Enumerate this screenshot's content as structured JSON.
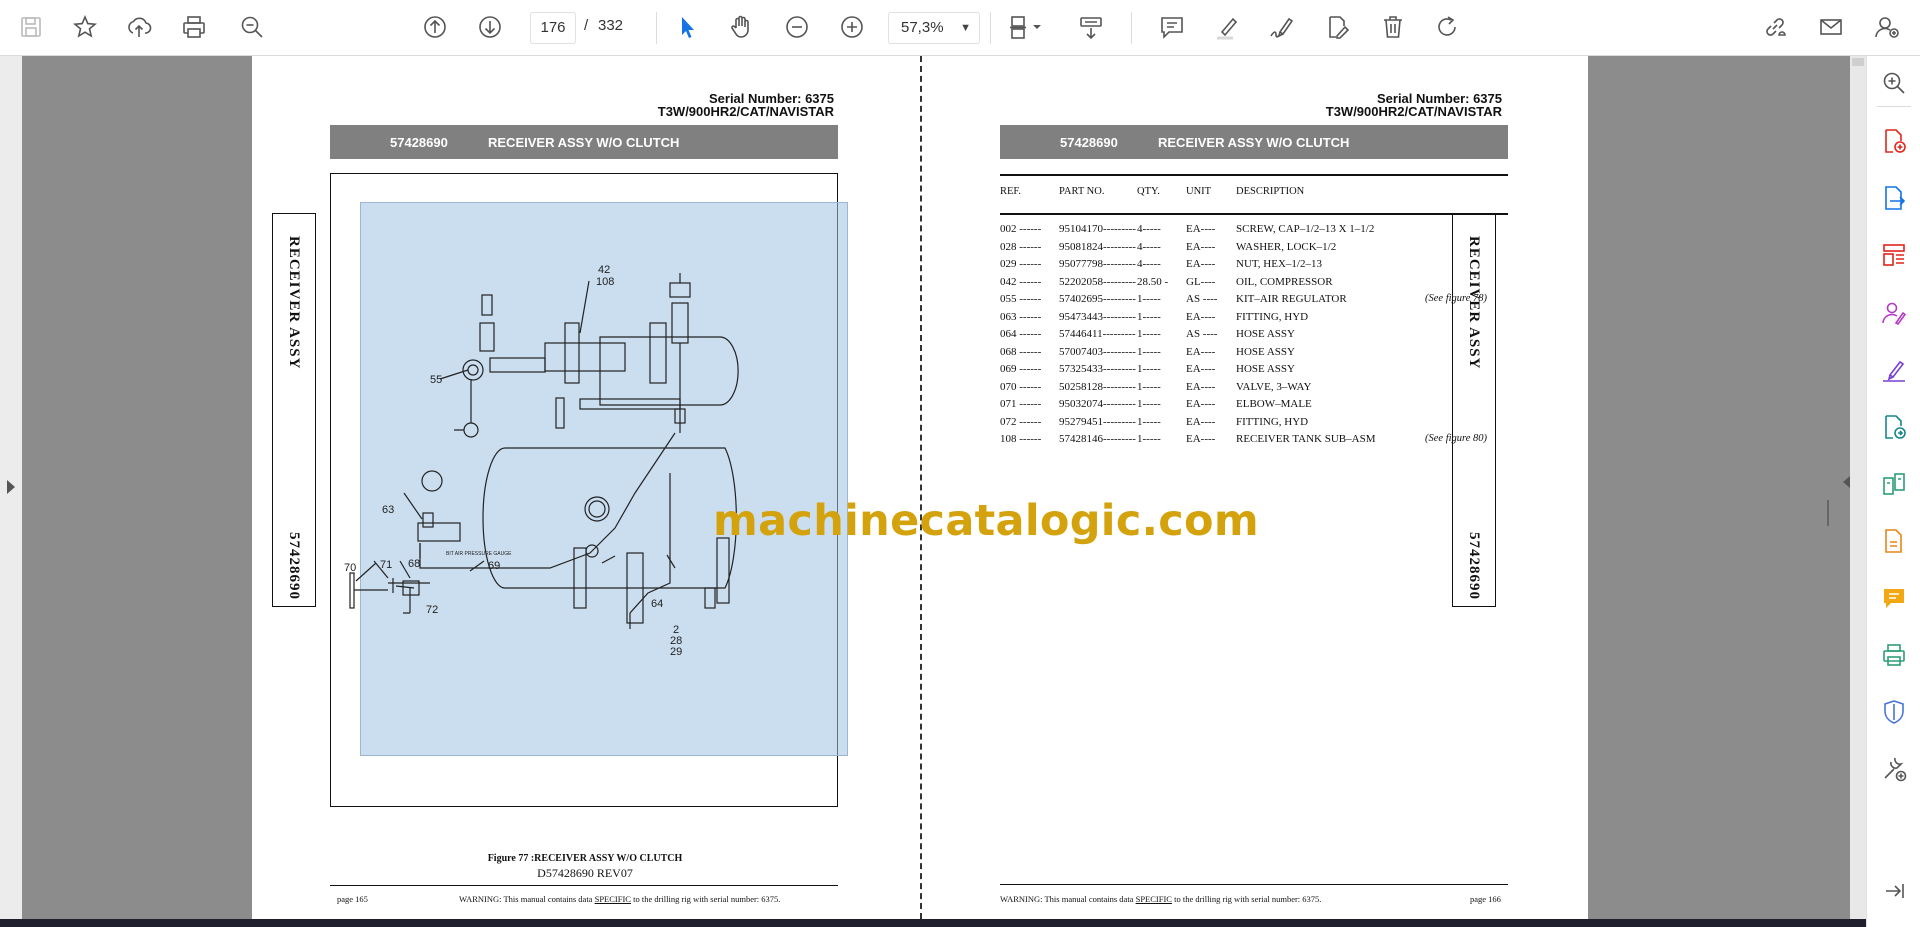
{
  "toolbar": {
    "page_current": "176",
    "page_separator": "/",
    "page_total": "332",
    "zoom": "57,3%",
    "icons": [
      "save-icon",
      "star-icon",
      "upload-icon",
      "print-icon",
      "zoom-search-icon",
      "page-up-icon",
      "page-down-icon",
      "select-cursor-icon",
      "hand-icon",
      "zoom-out-icon",
      "zoom-in-icon",
      "fit-page-icon",
      "scroll-mode-icon",
      "comment-icon",
      "highlight-icon",
      "sign-icon",
      "edit-pdf-icon",
      "delete-icon",
      "rotate-icon",
      "share-link-icon",
      "mail-icon",
      "account-icon"
    ],
    "accent": "#1473e6"
  },
  "sidebar": {
    "icons": [
      "zoom-icon",
      "create-pdf-icon",
      "export-pdf-icon",
      "organize-pages-icon",
      "request-signature-icon",
      "fill-sign-icon",
      "convert-pdf-icon",
      "compare-icon",
      "edit-pdf-icon",
      "comment-icon",
      "print-production-icon",
      "protect-icon",
      "more-tools-icon",
      "expand-panel-icon"
    ]
  },
  "left_page": {
    "serial_line1": "Serial Number: 6375",
    "serial_line2": "T3W/900HR2/CAT/NAVISTAR",
    "banner_number": "57428690",
    "banner_title": "RECEIVER ASSY W/O CLUTCH",
    "side_tab_title": "RECEIVER ASSY",
    "side_tab_number": "57428690",
    "diagram_labels": [
      "42",
      "108",
      "55",
      "63",
      "BIT AIR PRESSURE GAUGE",
      "70",
      "71",
      "68",
      "72",
      "69",
      "64",
      "2",
      "28",
      "29"
    ],
    "figure_caption": "Figure 77 :RECEIVER ASSY W/O CLUTCH",
    "figure_ref": "D57428690 REV07",
    "footer_page": "page 165",
    "footer_warning_pre": "WARNING:  This manual contains data ",
    "footer_warning_em": "SPECIFIC",
    "footer_warning_post": " to the drilling rig with serial number: 6375."
  },
  "right_page": {
    "serial_line1": "Serial Number: 6375",
    "serial_line2": "T3W/900HR2/CAT/NAVISTAR",
    "banner_number": "57428690",
    "banner_title": "RECEIVER ASSY W/O CLUTCH",
    "side_tab_title": "RECEIVER ASSY",
    "side_tab_number": "57428690",
    "headers": {
      "ref": "REF.",
      "part": "PART NO.",
      "qty": "QTY.",
      "unit": "UNIT",
      "desc": "DESCRIPTION"
    },
    "rows": [
      {
        "ref": "002 ------",
        "part": "95104170---------",
        "qty": "4-----",
        "unit": "EA----",
        "desc": "SCREW, CAP–1/2–13 X 1–1/2",
        "note": ""
      },
      {
        "ref": "028 ------",
        "part": "95081824---------",
        "qty": "4-----",
        "unit": "EA----",
        "desc": "WASHER, LOCK–1/2",
        "note": ""
      },
      {
        "ref": "029 ------",
        "part": "95077798---------",
        "qty": "4-----",
        "unit": "EA----",
        "desc": "NUT, HEX–1/2–13",
        "note": ""
      },
      {
        "ref": "042 ------",
        "part": "52202058---------",
        "qty": "28.50 -",
        "unit": "GL----",
        "desc": "OIL, COMPRESSOR",
        "note": ""
      },
      {
        "ref": "055 ------",
        "part": "57402695---------",
        "qty": "1-----",
        "unit": "AS ----",
        "desc": "KIT–AIR REGULATOR",
        "note": "(See figure 78)"
      },
      {
        "ref": "063 ------",
        "part": "95473443---------",
        "qty": "1-----",
        "unit": "EA----",
        "desc": "FITTING, HYD",
        "note": ""
      },
      {
        "ref": "064 ------",
        "part": "57446411---------",
        "qty": "1-----",
        "unit": "AS ----",
        "desc": "HOSE ASSY",
        "note": ""
      },
      {
        "ref": "068 ------",
        "part": "57007403---------",
        "qty": "1-----",
        "unit": "EA----",
        "desc": "HOSE ASSY",
        "note": ""
      },
      {
        "ref": "069 ------",
        "part": "57325433---------",
        "qty": "1-----",
        "unit": "EA----",
        "desc": "HOSE ASSY",
        "note": ""
      },
      {
        "ref": "070 ------",
        "part": "50258128---------",
        "qty": "1-----",
        "unit": "EA----",
        "desc": "VALVE, 3–WAY",
        "note": ""
      },
      {
        "ref": "071 ------",
        "part": "95032074---------",
        "qty": "1-----",
        "unit": "EA----",
        "desc": "ELBOW–MALE",
        "note": ""
      },
      {
        "ref": "072 ------",
        "part": "95279451---------",
        "qty": "1-----",
        "unit": "EA----",
        "desc": "FITTING, HYD",
        "note": ""
      },
      {
        "ref": "108 ------",
        "part": "57428146---------",
        "qty": "1-----",
        "unit": "EA----",
        "desc": "RECEIVER TANK SUB–ASM",
        "note": "(See figure 80)"
      }
    ],
    "footer_page": "page 166",
    "footer_warning_pre": "WARNING:  This manual contains data ",
    "footer_warning_em": "SPECIFIC",
    "footer_warning_post": " to the drilling rig with serial number: 6375."
  },
  "watermark": "machinecatalogic.com",
  "colors": {
    "viewer_bg": "#8c8c8c",
    "banner": "#808080",
    "selection": "#a0c3e1",
    "watermark": "#d4a20c",
    "accent": "#1473e6"
  }
}
